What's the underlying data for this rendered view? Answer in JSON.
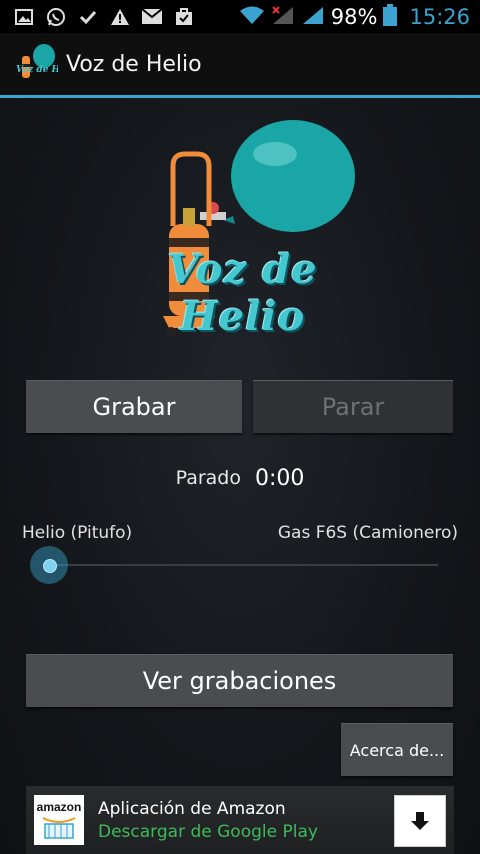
{
  "status_bar": {
    "battery_percent": "98%",
    "time": "15:26",
    "icons": [
      "picture-icon",
      "whatsapp-icon",
      "check-icon",
      "warning-icon",
      "mail-icon",
      "briefcase-icon",
      "wifi-icon",
      "signal-no-service-icon",
      "signal-icon",
      "battery-icon"
    ]
  },
  "app_bar": {
    "title": "Voz de Helio",
    "accent": "#3aa3cf"
  },
  "logo": {
    "text": "Voz de Helio",
    "balloon_color": "#1aa6a6",
    "tank_color": "#f08c3a"
  },
  "controls": {
    "record_label": "Grabar",
    "stop_label": "Parar",
    "stop_enabled": false
  },
  "status": {
    "label": "Parado",
    "time": "0:00"
  },
  "slider": {
    "left_label": "Helio (Pitufo)",
    "right_label": "Gas F6S (Camionero)",
    "value": 0
  },
  "buttons": {
    "recordings_label": "Ver grabaciones",
    "about_label": "Acerca de..."
  },
  "ad": {
    "logo_text": "amazon",
    "title": "Aplicación de Amazon",
    "subtitle": "Descargar de Google Play",
    "subtitle_color": "#3dbb5b"
  }
}
